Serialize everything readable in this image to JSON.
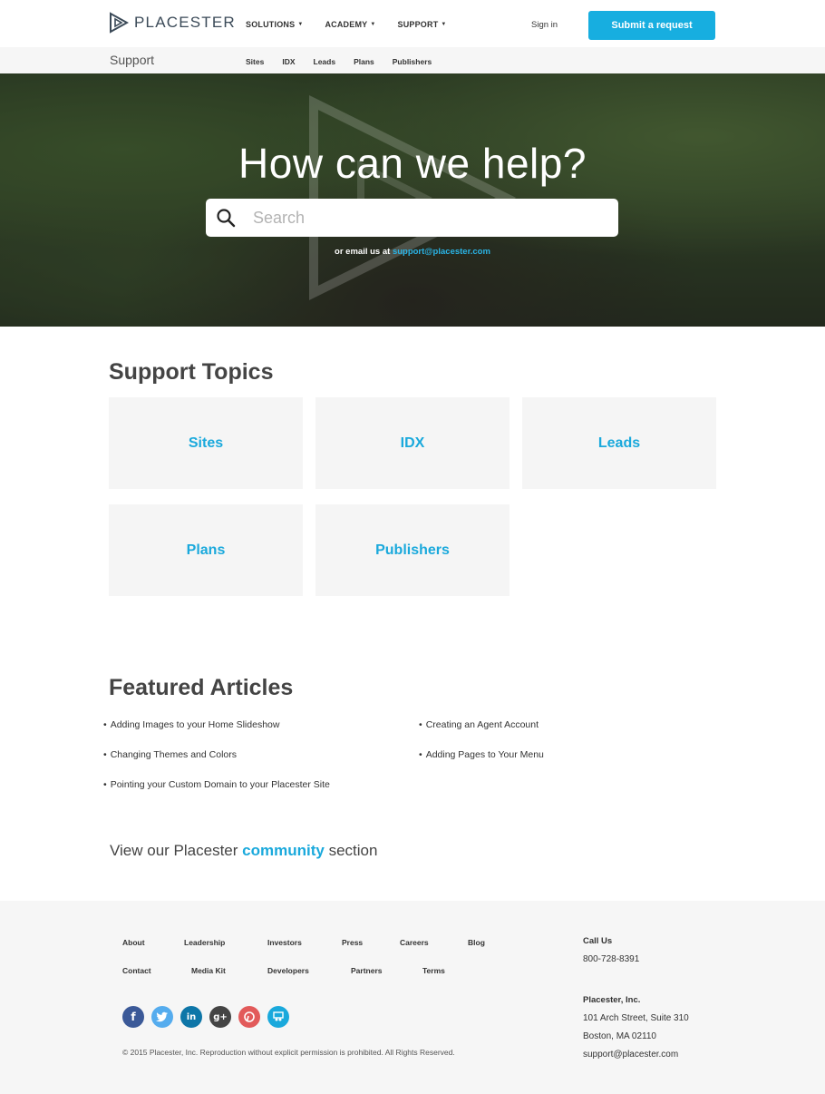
{
  "header": {
    "brand": "PLACESTER",
    "nav": [
      {
        "label": "SOLUTIONS"
      },
      {
        "label": "ACADEMY"
      },
      {
        "label": "SUPPORT"
      }
    ],
    "signin_label": "Sign in",
    "submit_label": "Submit a request"
  },
  "subnav": {
    "title": "Support",
    "links": [
      "Sites",
      "IDX",
      "Leads",
      "Plans",
      "Publishers"
    ]
  },
  "hero": {
    "heading": "How can we help?",
    "search_placeholder": "Search",
    "search_value": "",
    "email_prefix": "or email us at",
    "email": "support@placester.com"
  },
  "topics": {
    "title": "Support Topics",
    "items": [
      "Sites",
      "IDX",
      "Leads",
      "Plans",
      "Publishers"
    ]
  },
  "articles": {
    "title": "Featured Articles",
    "left": [
      "Adding Images to your Home Slideshow",
      "Changing Themes and Colors",
      "Pointing your Custom Domain to your Placester Site"
    ],
    "right": [
      "Creating an Agent Account",
      "Adding Pages to Your Menu"
    ]
  },
  "community": {
    "prefix": "View our Placester",
    "link": "community",
    "suffix": "section"
  },
  "footer": {
    "links_row1": [
      "About",
      "Leadership",
      "Investors",
      "Press",
      "Careers",
      "Blog"
    ],
    "links_row2": [
      "Contact",
      "Media Kit",
      "Developers",
      "Partners",
      "Terms"
    ],
    "socials": [
      {
        "name": "facebook-icon",
        "glyph": "f",
        "color": "#3b5998"
      },
      {
        "name": "twitter-icon",
        "glyph": "t",
        "color": "#55acee"
      },
      {
        "name": "linkedin-icon",
        "glyph": "in",
        "color": "#0e76a8"
      },
      {
        "name": "googleplus-icon",
        "glyph": "g+",
        "color": "#444444"
      },
      {
        "name": "pinterest-icon",
        "glyph": "p",
        "color": "#e25a5a"
      },
      {
        "name": "slideshare-icon",
        "glyph": "s",
        "color": "#1aa9dc"
      }
    ],
    "copyright": "© 2015 Placester, Inc. Reproduction without explicit permission is prohibited. All Rights Reserved.",
    "call_label": "Call Us",
    "phone": "800-728-8391",
    "company": "Placester, Inc.",
    "address1": "101 Arch Street, Suite 310",
    "address2": "Boston, MA 02110",
    "email": "support@placester.com"
  },
  "colors": {
    "accent": "#17aee0",
    "footer_bg": "#f6f6f6",
    "tile_bg": "#f5f5f5"
  }
}
